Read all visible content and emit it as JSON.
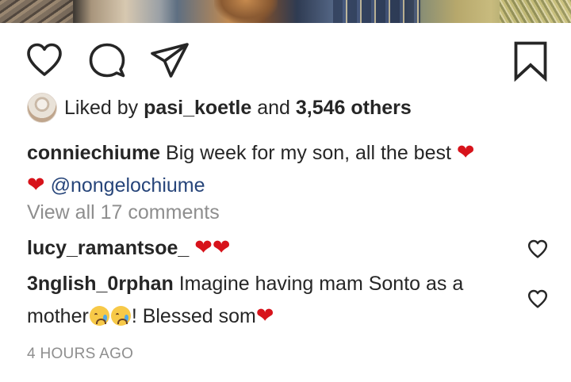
{
  "post": {
    "photo_alt": "post image (cropped)",
    "actions": {
      "like_icon": "heart-outline-icon",
      "comment_icon": "speech-bubble-icon",
      "share_icon": "paper-plane-icon",
      "save_icon": "bookmark-icon"
    },
    "likes": {
      "prefix": "Liked by ",
      "liker": "pasi_koetle",
      "middle": " and ",
      "count": "3,546 others"
    },
    "caption": {
      "username": "conniechiume",
      "text": " Big week for my son, all the best ",
      "heart1": "❤",
      "heart2": "❤",
      "mention": "@nongelochiume"
    },
    "view_all": "View all 17 comments",
    "comments": [
      {
        "username": "lucy_ramantsoe_",
        "hearts": "❤❤"
      },
      {
        "username": "3nglish_0rphan",
        "text_part1": " Imagine having mam Sonto as a mother",
        "text_part2": "! Blessed som",
        "heart": "❤"
      }
    ],
    "timestamp": "4 HOURS AGO"
  },
  "colors": {
    "text": "#262626",
    "muted": "#8e8e8e",
    "mention": "#27457a",
    "heart": "#d7131b"
  }
}
